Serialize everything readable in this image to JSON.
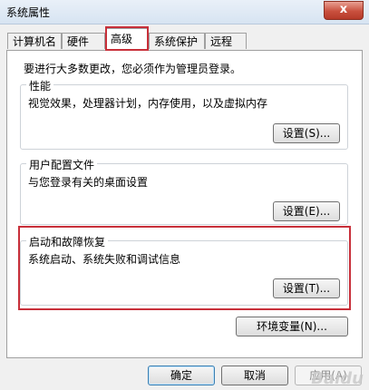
{
  "window": {
    "title": "系统属性",
    "close_symbol": "x"
  },
  "tabs": [
    {
      "label": "计算机名"
    },
    {
      "label": "硬件"
    },
    {
      "label": "高级"
    },
    {
      "label": "系统保护"
    },
    {
      "label": "远程"
    }
  ],
  "advanced": {
    "notice": "要进行大多数更改，您必须作为管理员登录。",
    "performance": {
      "title": "性能",
      "description": "视觉效果，处理器计划，内存使用，以及虚拟内存",
      "button": "设置(S)..."
    },
    "user_profiles": {
      "title": "用户配置文件",
      "description": "与您登录有关的桌面设置",
      "button": "设置(E)..."
    },
    "startup_recovery": {
      "title": "启动和故障恢复",
      "description": "系统启动、系统失败和调试信息",
      "button": "设置(T)..."
    },
    "env_button": "环境变量(N)..."
  },
  "footer": {
    "ok": "确定",
    "cancel": "取消",
    "apply": "应用(A)"
  },
  "watermark": "Baidu"
}
